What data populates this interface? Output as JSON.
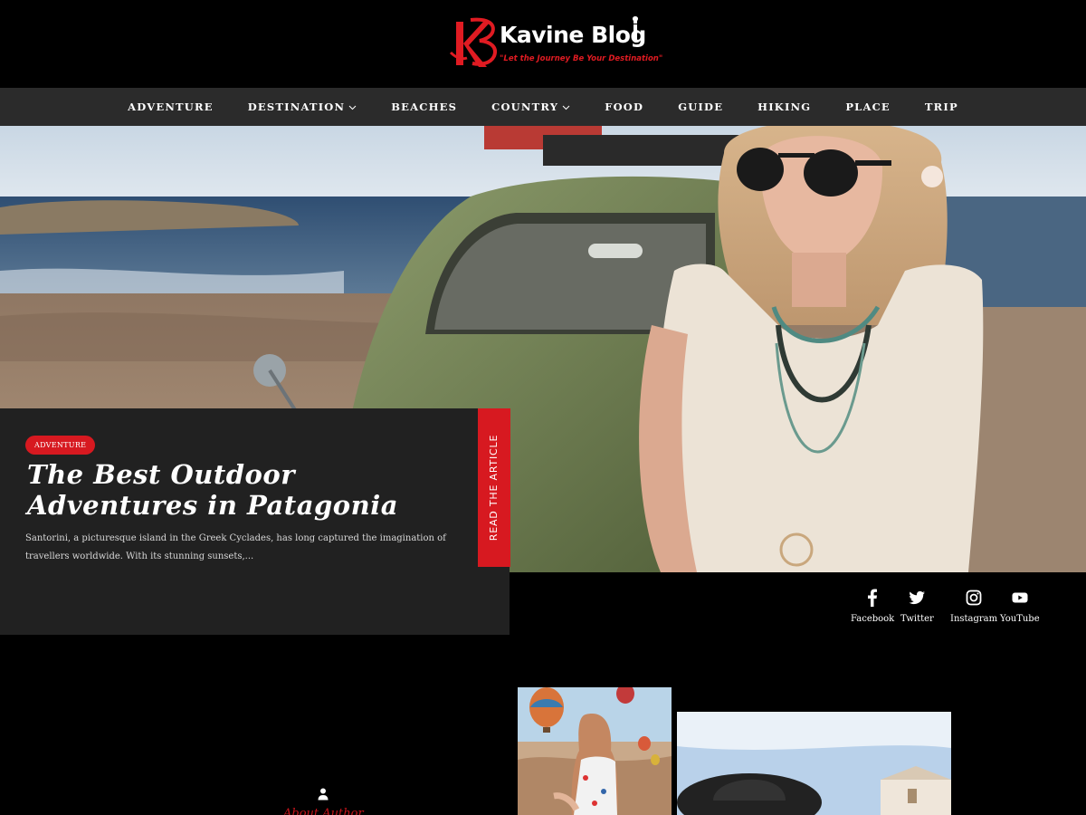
{
  "brand": {
    "logo_initials": "KB",
    "name": "Kavine Blog",
    "tagline": "\"Let the Journey Be Your Destination\"",
    "accent_color": "#e01b22"
  },
  "nav": {
    "items": [
      {
        "label": "ADVENTURE",
        "has_dropdown": false
      },
      {
        "label": "DESTINATION",
        "has_dropdown": true
      },
      {
        "label": "BEACHES",
        "has_dropdown": false
      },
      {
        "label": "COUNTRY",
        "has_dropdown": true
      },
      {
        "label": "FOOD",
        "has_dropdown": false
      },
      {
        "label": "GUIDE",
        "has_dropdown": false
      },
      {
        "label": "HIKING",
        "has_dropdown": false
      },
      {
        "label": "PLACE",
        "has_dropdown": false
      },
      {
        "label": "TRIP",
        "has_dropdown": false
      }
    ]
  },
  "hero": {
    "category": "ADVENTURE",
    "title": "The Best Outdoor Adventures in Patagonia",
    "excerpt": "Santorini, a picturesque island in the Greek Cyclades, has long captured the imagination of travellers worldwide. With its stunning sunsets,...",
    "read_more": "READ THE ARTICLE"
  },
  "social": [
    {
      "label": "Facebook",
      "icon": "facebook-icon"
    },
    {
      "label": "Twitter",
      "icon": "twitter-icon"
    },
    {
      "label": "Instagram",
      "icon": "instagram-icon"
    },
    {
      "label": "YouTube",
      "icon": "youtube-icon"
    }
  ],
  "about": {
    "label": "About Author",
    "icon": "user-icon"
  }
}
